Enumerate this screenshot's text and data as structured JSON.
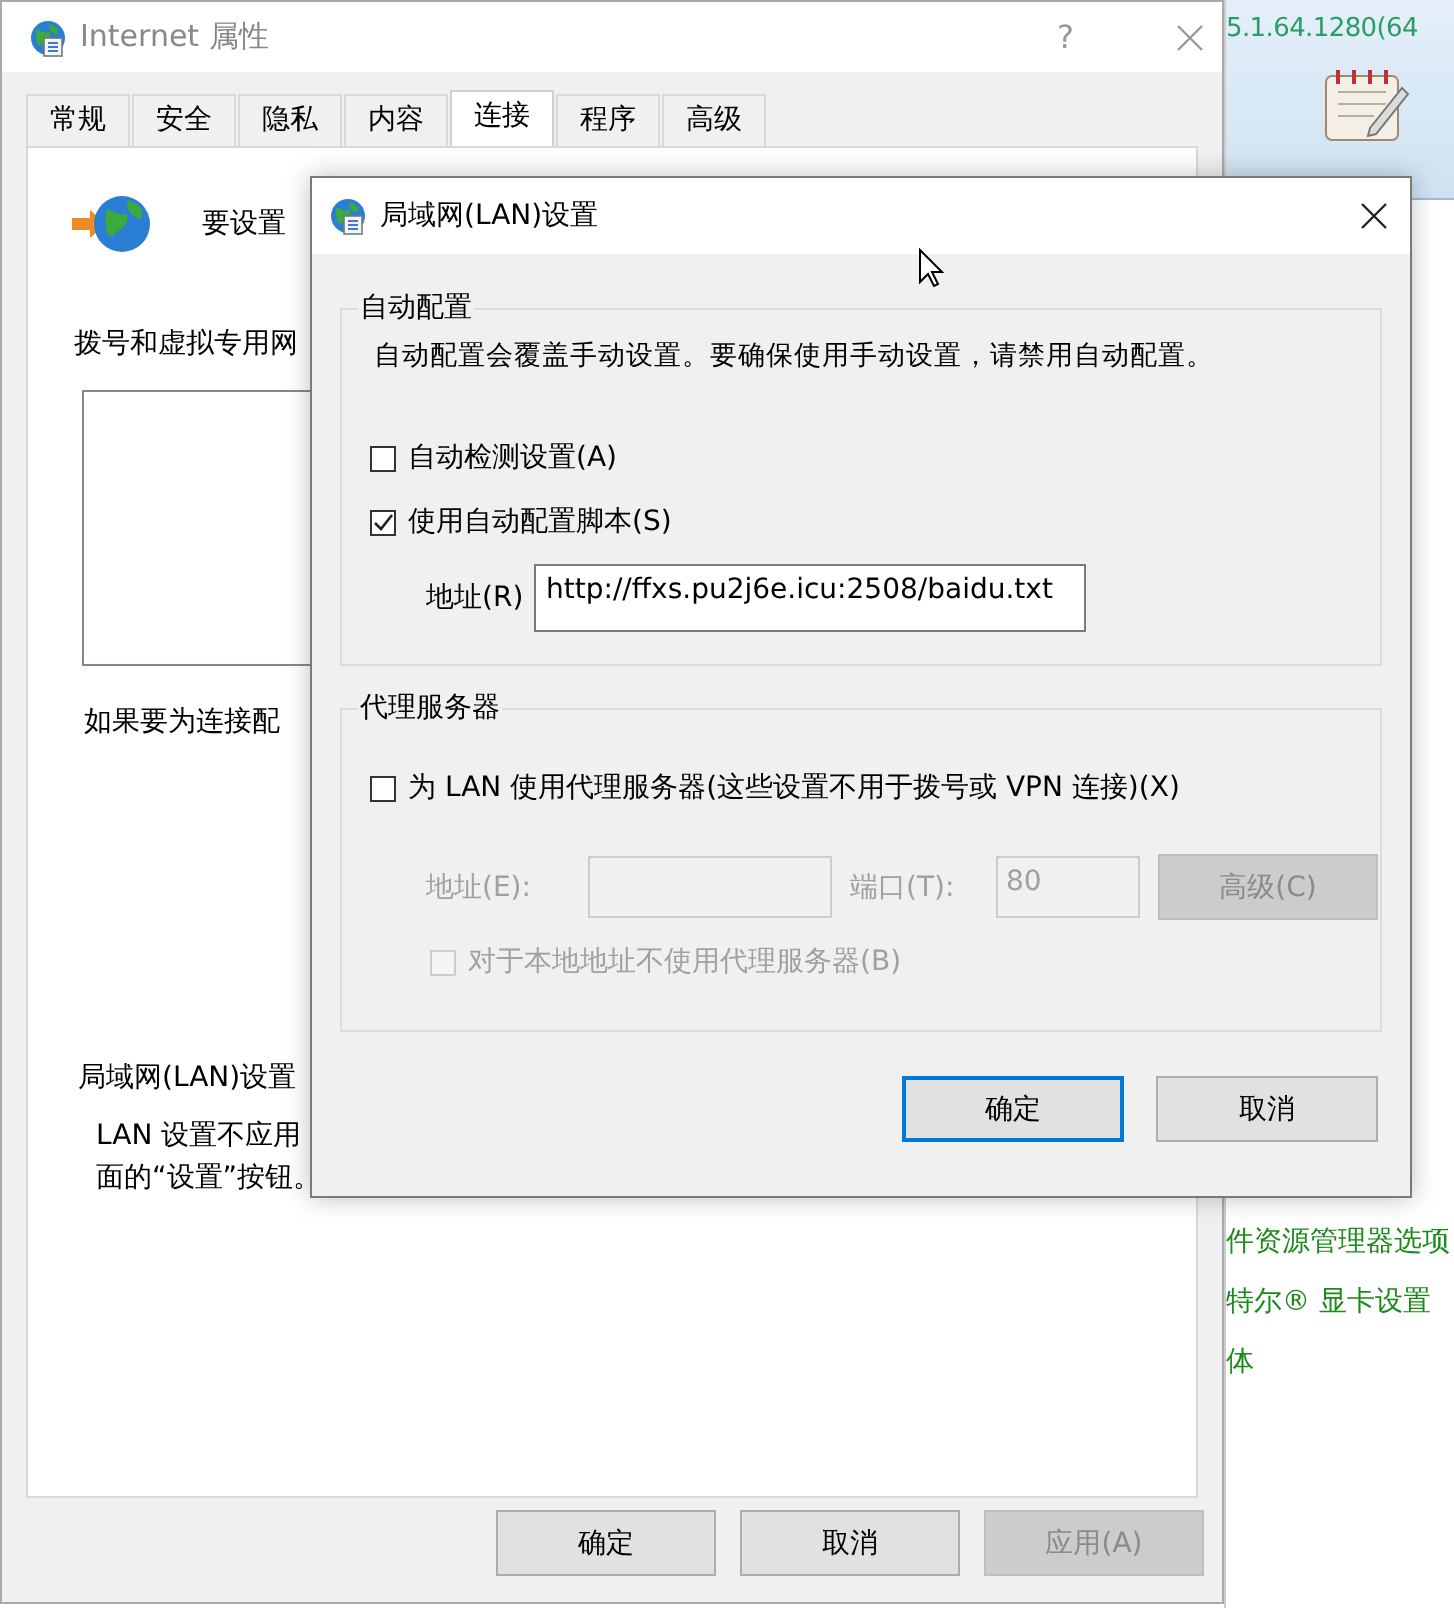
{
  "main_window": {
    "title": "Internet 属性",
    "help": "?",
    "tabs": [
      {
        "label": "常规",
        "selected": false
      },
      {
        "label": "安全",
        "selected": false
      },
      {
        "label": "隐私",
        "selected": false
      },
      {
        "label": "内容",
        "selected": false
      },
      {
        "label": "连接",
        "selected": true
      },
      {
        "label": "程序",
        "selected": false
      },
      {
        "label": "高级",
        "selected": false
      }
    ],
    "connection_panel": {
      "setup_text": "要设置",
      "dialup_heading": "拨号和虚拟专用网",
      "configure_text": "如果要为连接配",
      "lan_heading": "局域网(LAN)设置",
      "lan_note_lines": [
        "LAN 设置不应用",
        "面的“设置”按钮。"
      ]
    },
    "buttons": [
      {
        "label": "确定",
        "disabled": false
      },
      {
        "label": "取消",
        "disabled": false
      },
      {
        "label": "应用(A)",
        "disabled": true
      }
    ]
  },
  "lan_dialog": {
    "title": "局域网(LAN)设置",
    "auto_config": {
      "legend": "自动配置",
      "description": "自动配置会覆盖手动设置。要确保使用手动设置，请禁用自动配置。",
      "options": [
        {
          "label": "自动检测设置(A)",
          "checked": false
        },
        {
          "label": "使用自动配置脚本(S)",
          "checked": true
        }
      ],
      "address_label": "地址(R)",
      "address_value": "http://ffxs.pu2j6e.icu:2508/baidu.txt"
    },
    "proxy": {
      "legend": "代理服务器",
      "use_proxy": {
        "label": "为 LAN 使用代理服务器(这些设置不用于拨号或 VPN 连接)(X)",
        "checked": false
      },
      "disabled": true,
      "address_label": "地址(E):",
      "port_label": "端口(T):",
      "port_value": "80",
      "advanced": "高级(C)",
      "bypass": {
        "label": "对于本地地址不使用代理服务器(B)",
        "checked": false
      }
    },
    "buttons": [
      {
        "label": "确定",
        "default": true
      },
      {
        "label": "取消",
        "default": false
      }
    ]
  },
  "background_app": {
    "version_text": "5.1.64.1280(64",
    "links": [
      "件资源管理器选项",
      "特尔® 显卡设置",
      "体"
    ]
  }
}
